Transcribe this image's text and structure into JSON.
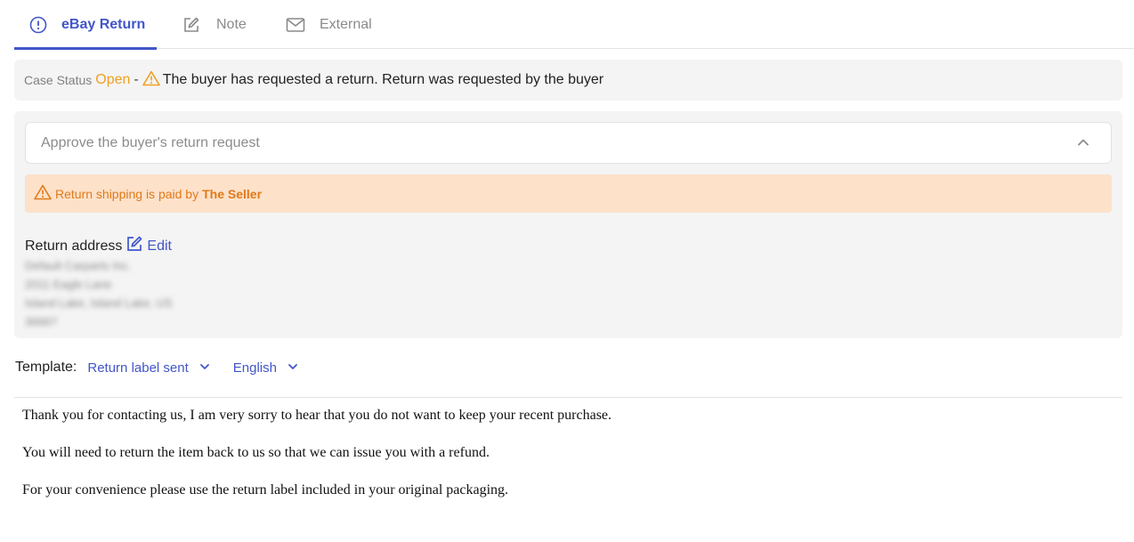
{
  "tabs": [
    {
      "label": "eBay Return",
      "icon": "alert-circle-icon",
      "active": true
    },
    {
      "label": "Note",
      "icon": "edit-note-icon",
      "active": false
    },
    {
      "label": "External",
      "icon": "mail-icon",
      "active": false
    }
  ],
  "status": {
    "key": "Case Status",
    "value": "Open",
    "dash": "-",
    "message": "The buyer has requested a return. Return was requested by the buyer"
  },
  "approve": {
    "label": "Approve the buyer's return request"
  },
  "shipping_warning": {
    "text": "Return shipping is paid by",
    "payer": "The Seller"
  },
  "return_address": {
    "label": "Return address",
    "edit_label": "Edit",
    "lines": [
      "Default Carparts Inc.",
      "2011 Eagle Lane",
      "Island Lake, Island Lake, US",
      "3666?"
    ]
  },
  "template": {
    "label": "Template:",
    "selected": "Return label sent",
    "language": "English"
  },
  "message": {
    "paragraphs": [
      "Thank you for contacting us, I am very sorry to hear that you do not want to keep your recent purchase.",
      "You will need to return the item back to us so that we can issue you with a refund.",
      "For your convenience please use the return label included in your original packaging."
    ]
  },
  "colors": {
    "accent": "#4256c9",
    "open_status": "#f0a020",
    "warning_bg": "#fde1c9",
    "warning_text": "#e07a1a"
  }
}
